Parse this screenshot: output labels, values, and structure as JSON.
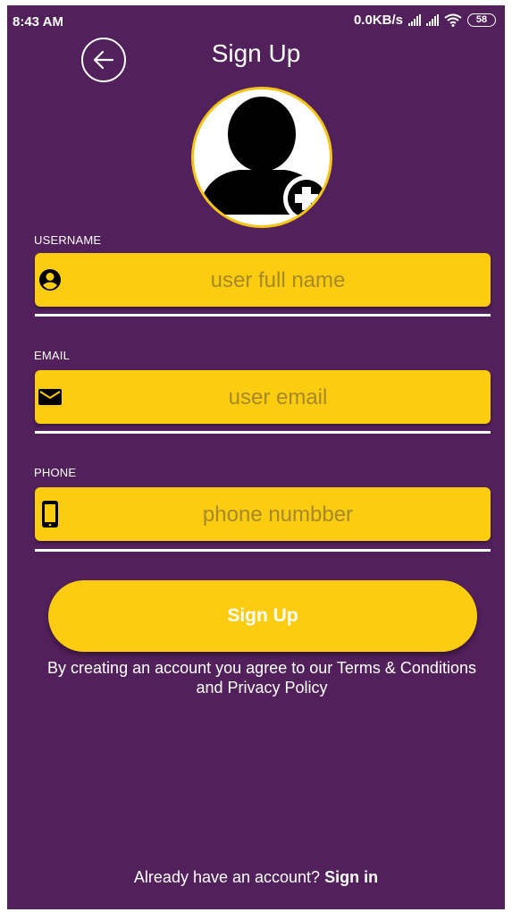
{
  "status_bar": {
    "time": "8:43 AM",
    "network_speed": "0.0KB/s",
    "battery_level": "58",
    "icons": [
      "signal-icon",
      "signal-icon",
      "wifi-icon",
      "battery-icon"
    ]
  },
  "header": {
    "back_icon": "arrow-left-icon",
    "title": "Sign Up"
  },
  "avatar": {
    "icon": "user-silhouette-icon",
    "badge_icon": "plus-circle-icon"
  },
  "form": {
    "username": {
      "label": "USERNAME",
      "placeholder": "user full name",
      "value": "",
      "icon": "user-circle-icon"
    },
    "email": {
      "label": "EMAIL",
      "placeholder": "user email",
      "value": "",
      "icon": "envelope-icon"
    },
    "phone": {
      "label": "PHONE",
      "placeholder": "phone numbber",
      "value": "",
      "icon": "mobile-phone-icon"
    }
  },
  "actions": {
    "signup_label": "Sign Up",
    "terms_text": "By creating an account you agree to our Terms & Conditions and Privacy Policy"
  },
  "footer": {
    "prompt": "Already have an account?",
    "signin_label": "Sign in"
  },
  "colors": {
    "background": "#52205b",
    "accent": "#fbcc0f",
    "text": "#ffffff"
  }
}
